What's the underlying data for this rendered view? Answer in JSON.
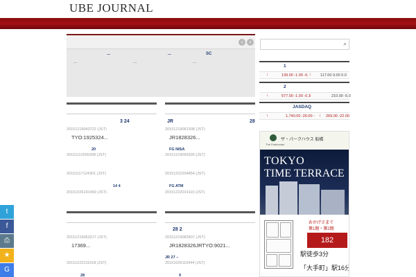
{
  "site": {
    "logo": "UBE JOURNAL"
  },
  "slider": {
    "prev_glyph": "‹",
    "next_glyph": "›",
    "items": [
      {
        "title": "...",
        "sub": "..."
      },
      {
        "title": "...",
        "sub": "..."
      },
      {
        "title": "SC",
        "sub": "..."
      }
    ]
  },
  "articles": {
    "col1_block1": [
      {
        "title": "3  24",
        "date": "20151219043722 (JST)",
        "body": "TYO:1925324..."
      },
      {
        "title": "20",
        "date": "20151112055208 (JST)"
      },
      {
        "title": "",
        "date": "20151117124301 (JST)"
      },
      {
        "title": "14        4",
        "date": "20151026191459 (JST)"
      }
    ],
    "col2_block1": [
      {
        "title_left": "JR",
        "title_right": "28",
        "date": "20151219081308 (JST)",
        "body": "JR1828326..."
      },
      {
        "title": "FG  NISA",
        "date": "20151219093326 (JST)"
      },
      {
        "title": "",
        "date": "20151222204854 (JST)"
      },
      {
        "title": "FG                  ATM",
        "date": "20151222014110 (JST)"
      }
    ],
    "col1_block2": [
      {
        "title": "",
        "date": "20151219063217 (JST)",
        "body": "17369..."
      },
      {
        "title": "",
        "date": "20151222211618 (JST)"
      },
      {
        "title": "28"
      }
    ],
    "col2_block2": [
      {
        "title": "28                2",
        "date": "20151219082807 (JST)",
        "body": "JR1828326JRTYO:9021..."
      },
      {
        "title": "JR        27                          –",
        "date": "20151026110944 (JST)"
      },
      {
        "title": "9"
      }
    ]
  },
  "search": {
    "icon": "search-icon"
  },
  "markets": [
    {
      "label": "1",
      "arrow": "↓",
      "value1": "139.00 -1.00 -0.",
      "arrow2": "↓",
      "value2": "117.00 0.00 0.0"
    },
    {
      "label": "2",
      "arrow": "↓",
      "value1": "577.00 -1.00 -0.1",
      "arrow2": "↓",
      "value2": "210.00 -5.0"
    },
    {
      "label": "JASDAQ",
      "arrow": "↓",
      "value1": "1,740.00 -26.00 -",
      "arrow2": "↓",
      "value2": "269.00 -22.00"
    }
  ],
  "ad": {
    "brand": "ザ・パークハウス 船橋",
    "small": "The Parkhouse",
    "line1": "TOKYO",
    "line2": "TIME TERRACE",
    "badge": "おかげさまで",
    "badge2": "第1期・第2期",
    "price": "182",
    "walk": "駅徒歩3分",
    "walk2": "「大手町」駅16分"
  },
  "share": [
    {
      "icon": "twitter-icon",
      "glyph": "t",
      "color": "#2fa2da"
    },
    {
      "icon": "facebook-icon",
      "glyph": "f",
      "color": "#3b5998"
    },
    {
      "icon": "print-icon",
      "glyph": "⎙",
      "color": "#5c7a8c"
    },
    {
      "icon": "star-icon",
      "glyph": "★",
      "color": "#f2b21b"
    },
    {
      "icon": "google-icon",
      "glyph": "G",
      "color": "#3f7de8"
    }
  ]
}
